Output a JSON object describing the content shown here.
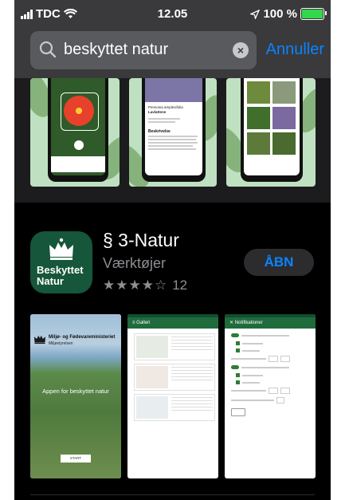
{
  "status": {
    "carrier": "TDC",
    "time": "12.05",
    "battery": "100 %"
  },
  "search": {
    "query": "beskyttet natur",
    "cancel_label": "Annuller"
  },
  "top_shots": {
    "plant_name": "Pensonia amplexifolia",
    "plant_sub": "Lavlattene",
    "section": "Beskrivelse"
  },
  "app": {
    "icon_label_line1": "Beskyttet",
    "icon_label_line2": "Natur",
    "name": "§ 3-Natur",
    "category": "Værktøjer",
    "stars": "★★★★☆",
    "rating_count": "12",
    "open_label": "ÅBN"
  },
  "screenshots": {
    "s1_ministry": "Miljø- og Fødevareministeriet",
    "s1_agency": "Miljøstyrelsen",
    "s1_tagline": "Appen for beskyttet natur",
    "s1_start": "START",
    "s2_title": "Galleri",
    "s3_title": "Notifikationer"
  }
}
